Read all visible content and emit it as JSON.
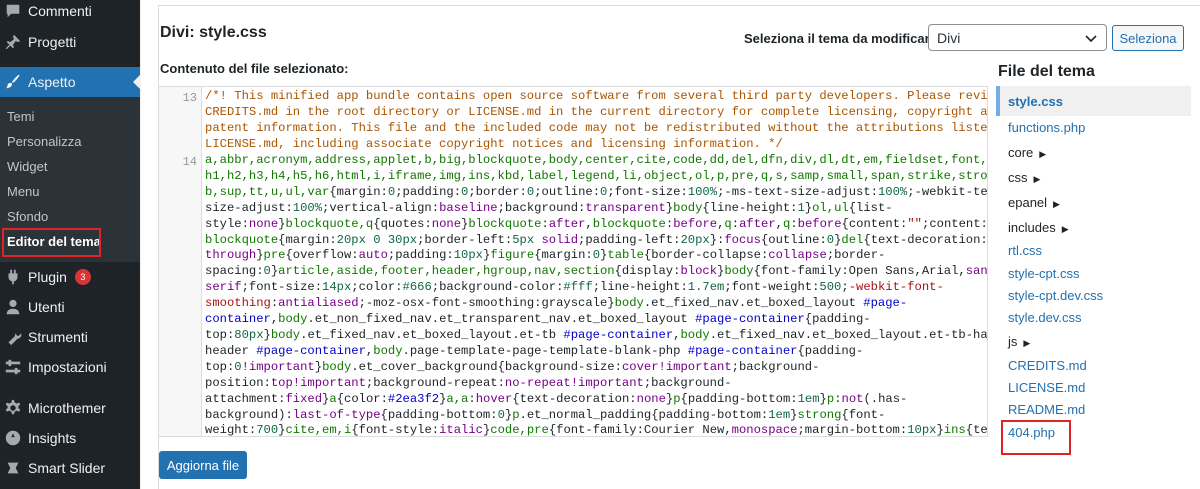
{
  "sidebar": {
    "items": [
      {
        "label": "Commenti",
        "icon": "comments-icon"
      },
      {
        "label": "Progetti",
        "icon": "pin-icon"
      },
      {
        "label": "Aspetto",
        "icon": "paintbrush-icon"
      },
      {
        "label": "Plugin",
        "icon": "plugin-icon",
        "badge": "3"
      },
      {
        "label": "Utenti",
        "icon": "users-icon"
      },
      {
        "label": "Strumenti",
        "icon": "wrench-icon"
      },
      {
        "label": "Impostazioni",
        "icon": "settings-icon"
      },
      {
        "label": "Microthemer",
        "icon": "gear-icon"
      },
      {
        "label": "Insights",
        "icon": "insights-icon"
      },
      {
        "label": "Smart Slider",
        "icon": "slider-icon"
      }
    ],
    "submenu": [
      "Temi",
      "Personalizza",
      "Widget",
      "Menu",
      "Sfondo",
      "Editor del tema"
    ]
  },
  "header": {
    "file_title": "Divi: style.css",
    "select_label": "Seleziona il tema da modificare:",
    "select_value": "Divi",
    "select_button": "Seleziona"
  },
  "editor": {
    "content_label": "Contenuto del file selezionato:",
    "line_numbers": [
      "13",
      "14"
    ],
    "comment_lines": [
      "/*! This minified app bundle contains open source software from several third party developers. Please review",
      "CREDITS.md in the root directory or LICENSE.md in the current directory for complete licensing, copyright and",
      "patent information. This file and the included code may not be redistributed without the attributions listed in",
      "LICENSE.md, including associate copyright notices and licensing information. */"
    ],
    "update_button": "Aggiorna file"
  },
  "files": {
    "title": "File del tema",
    "items": [
      {
        "label": "style.css",
        "type": "file",
        "current": true
      },
      {
        "label": "functions.php",
        "type": "file"
      },
      {
        "label": "core",
        "type": "folder"
      },
      {
        "label": "css",
        "type": "folder"
      },
      {
        "label": "epanel",
        "type": "folder"
      },
      {
        "label": "includes",
        "type": "folder"
      },
      {
        "label": "rtl.css",
        "type": "file"
      },
      {
        "label": "style-cpt.css",
        "type": "file"
      },
      {
        "label": "style-cpt.dev.css",
        "type": "file"
      },
      {
        "label": "style.dev.css",
        "type": "file"
      },
      {
        "label": "js",
        "type": "folder"
      },
      {
        "label": "CREDITS.md",
        "type": "file"
      },
      {
        "label": "LICENSE.md",
        "type": "file"
      },
      {
        "label": "README.md",
        "type": "file"
      },
      {
        "label": "404.php",
        "type": "file"
      }
    ]
  },
  "colors": {
    "sidebar_bg": "#1d2327",
    "accent": "#2271b1",
    "highlight_box": "#e02424",
    "badge": "#d63638"
  }
}
